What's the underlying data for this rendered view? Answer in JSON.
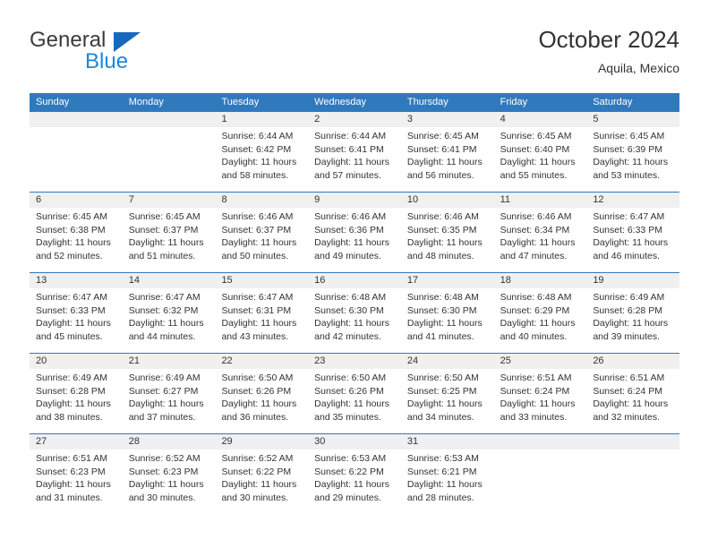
{
  "brand": {
    "name_top": "General",
    "name_bottom": "Blue",
    "triangle_color": "#1669bb",
    "top_color": "#3b3b3b",
    "bottom_color": "#1b87dd"
  },
  "header": {
    "title": "October 2024",
    "subtitle": "Aquila, Mexico"
  },
  "theme": {
    "header_blue": "#3179bd",
    "daynum_bg": "#f0f0f0",
    "text": "#333333"
  },
  "calendar": {
    "weekdays": [
      "Sunday",
      "Monday",
      "Tuesday",
      "Wednesday",
      "Thursday",
      "Friday",
      "Saturday"
    ],
    "labels": {
      "sunrise": "Sunrise:",
      "sunset": "Sunset:",
      "daylight": "Daylight:"
    },
    "weeks": [
      [
        {
          "day": "",
          "empty": true
        },
        {
          "day": "",
          "empty": true
        },
        {
          "day": "1",
          "sunrise": "Sunrise: 6:44 AM",
          "sunset": "Sunset: 6:42 PM",
          "daylight1": "Daylight: 11 hours",
          "daylight2": "and 58 minutes."
        },
        {
          "day": "2",
          "sunrise": "Sunrise: 6:44 AM",
          "sunset": "Sunset: 6:41 PM",
          "daylight1": "Daylight: 11 hours",
          "daylight2": "and 57 minutes."
        },
        {
          "day": "3",
          "sunrise": "Sunrise: 6:45 AM",
          "sunset": "Sunset: 6:41 PM",
          "daylight1": "Daylight: 11 hours",
          "daylight2": "and 56 minutes."
        },
        {
          "day": "4",
          "sunrise": "Sunrise: 6:45 AM",
          "sunset": "Sunset: 6:40 PM",
          "daylight1": "Daylight: 11 hours",
          "daylight2": "and 55 minutes."
        },
        {
          "day": "5",
          "sunrise": "Sunrise: 6:45 AM",
          "sunset": "Sunset: 6:39 PM",
          "daylight1": "Daylight: 11 hours",
          "daylight2": "and 53 minutes."
        }
      ],
      [
        {
          "day": "6",
          "sunrise": "Sunrise: 6:45 AM",
          "sunset": "Sunset: 6:38 PM",
          "daylight1": "Daylight: 11 hours",
          "daylight2": "and 52 minutes."
        },
        {
          "day": "7",
          "sunrise": "Sunrise: 6:45 AM",
          "sunset": "Sunset: 6:37 PM",
          "daylight1": "Daylight: 11 hours",
          "daylight2": "and 51 minutes."
        },
        {
          "day": "8",
          "sunrise": "Sunrise: 6:46 AM",
          "sunset": "Sunset: 6:37 PM",
          "daylight1": "Daylight: 11 hours",
          "daylight2": "and 50 minutes."
        },
        {
          "day": "9",
          "sunrise": "Sunrise: 6:46 AM",
          "sunset": "Sunset: 6:36 PM",
          "daylight1": "Daylight: 11 hours",
          "daylight2": "and 49 minutes."
        },
        {
          "day": "10",
          "sunrise": "Sunrise: 6:46 AM",
          "sunset": "Sunset: 6:35 PM",
          "daylight1": "Daylight: 11 hours",
          "daylight2": "and 48 minutes."
        },
        {
          "day": "11",
          "sunrise": "Sunrise: 6:46 AM",
          "sunset": "Sunset: 6:34 PM",
          "daylight1": "Daylight: 11 hours",
          "daylight2": "and 47 minutes."
        },
        {
          "day": "12",
          "sunrise": "Sunrise: 6:47 AM",
          "sunset": "Sunset: 6:33 PM",
          "daylight1": "Daylight: 11 hours",
          "daylight2": "and 46 minutes."
        }
      ],
      [
        {
          "day": "13",
          "sunrise": "Sunrise: 6:47 AM",
          "sunset": "Sunset: 6:33 PM",
          "daylight1": "Daylight: 11 hours",
          "daylight2": "and 45 minutes."
        },
        {
          "day": "14",
          "sunrise": "Sunrise: 6:47 AM",
          "sunset": "Sunset: 6:32 PM",
          "daylight1": "Daylight: 11 hours",
          "daylight2": "and 44 minutes."
        },
        {
          "day": "15",
          "sunrise": "Sunrise: 6:47 AM",
          "sunset": "Sunset: 6:31 PM",
          "daylight1": "Daylight: 11 hours",
          "daylight2": "and 43 minutes."
        },
        {
          "day": "16",
          "sunrise": "Sunrise: 6:48 AM",
          "sunset": "Sunset: 6:30 PM",
          "daylight1": "Daylight: 11 hours",
          "daylight2": "and 42 minutes."
        },
        {
          "day": "17",
          "sunrise": "Sunrise: 6:48 AM",
          "sunset": "Sunset: 6:30 PM",
          "daylight1": "Daylight: 11 hours",
          "daylight2": "and 41 minutes."
        },
        {
          "day": "18",
          "sunrise": "Sunrise: 6:48 AM",
          "sunset": "Sunset: 6:29 PM",
          "daylight1": "Daylight: 11 hours",
          "daylight2": "and 40 minutes."
        },
        {
          "day": "19",
          "sunrise": "Sunrise: 6:49 AM",
          "sunset": "Sunset: 6:28 PM",
          "daylight1": "Daylight: 11 hours",
          "daylight2": "and 39 minutes."
        }
      ],
      [
        {
          "day": "20",
          "sunrise": "Sunrise: 6:49 AM",
          "sunset": "Sunset: 6:28 PM",
          "daylight1": "Daylight: 11 hours",
          "daylight2": "and 38 minutes."
        },
        {
          "day": "21",
          "sunrise": "Sunrise: 6:49 AM",
          "sunset": "Sunset: 6:27 PM",
          "daylight1": "Daylight: 11 hours",
          "daylight2": "and 37 minutes."
        },
        {
          "day": "22",
          "sunrise": "Sunrise: 6:50 AM",
          "sunset": "Sunset: 6:26 PM",
          "daylight1": "Daylight: 11 hours",
          "daylight2": "and 36 minutes."
        },
        {
          "day": "23",
          "sunrise": "Sunrise: 6:50 AM",
          "sunset": "Sunset: 6:26 PM",
          "daylight1": "Daylight: 11 hours",
          "daylight2": "and 35 minutes."
        },
        {
          "day": "24",
          "sunrise": "Sunrise: 6:50 AM",
          "sunset": "Sunset: 6:25 PM",
          "daylight1": "Daylight: 11 hours",
          "daylight2": "and 34 minutes."
        },
        {
          "day": "25",
          "sunrise": "Sunrise: 6:51 AM",
          "sunset": "Sunset: 6:24 PM",
          "daylight1": "Daylight: 11 hours",
          "daylight2": "and 33 minutes."
        },
        {
          "day": "26",
          "sunrise": "Sunrise: 6:51 AM",
          "sunset": "Sunset: 6:24 PM",
          "daylight1": "Daylight: 11 hours",
          "daylight2": "and 32 minutes."
        }
      ],
      [
        {
          "day": "27",
          "sunrise": "Sunrise: 6:51 AM",
          "sunset": "Sunset: 6:23 PM",
          "daylight1": "Daylight: 11 hours",
          "daylight2": "and 31 minutes."
        },
        {
          "day": "28",
          "sunrise": "Sunrise: 6:52 AM",
          "sunset": "Sunset: 6:23 PM",
          "daylight1": "Daylight: 11 hours",
          "daylight2": "and 30 minutes."
        },
        {
          "day": "29",
          "sunrise": "Sunrise: 6:52 AM",
          "sunset": "Sunset: 6:22 PM",
          "daylight1": "Daylight: 11 hours",
          "daylight2": "and 30 minutes."
        },
        {
          "day": "30",
          "sunrise": "Sunrise: 6:53 AM",
          "sunset": "Sunset: 6:22 PM",
          "daylight1": "Daylight: 11 hours",
          "daylight2": "and 29 minutes."
        },
        {
          "day": "31",
          "sunrise": "Sunrise: 6:53 AM",
          "sunset": "Sunset: 6:21 PM",
          "daylight1": "Daylight: 11 hours",
          "daylight2": "and 28 minutes."
        },
        {
          "day": "",
          "empty": true
        },
        {
          "day": "",
          "empty": true
        }
      ]
    ]
  }
}
